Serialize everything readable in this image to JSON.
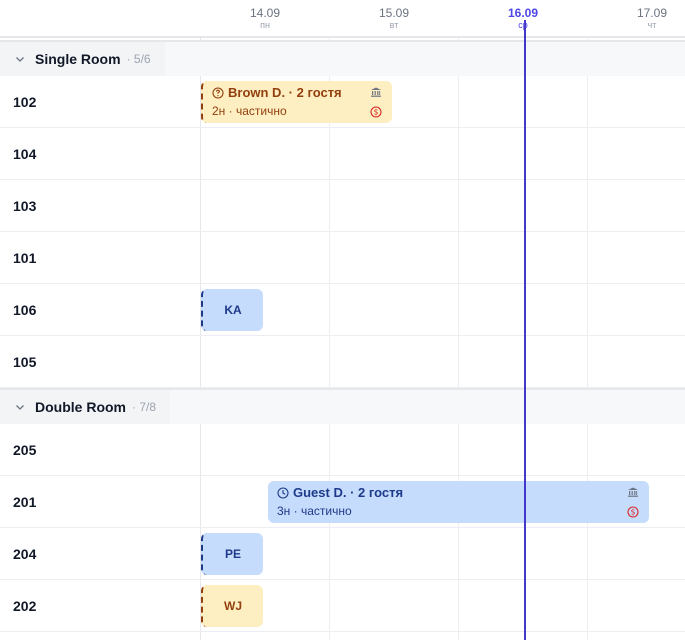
{
  "days": [
    {
      "date": "14.09",
      "dow": "пн",
      "today": false
    },
    {
      "date": "15.09",
      "dow": "вт",
      "today": false
    },
    {
      "date": "16.09",
      "dow": "ср",
      "today": true
    },
    {
      "date": "17.09",
      "dow": "чт",
      "today": false
    }
  ],
  "groups": [
    {
      "name": "Single Room",
      "count": "· 5/6",
      "rooms": [
        "102",
        "104",
        "103",
        "101",
        "106",
        "105"
      ]
    },
    {
      "name": "Double Room",
      "count": "· 7/8",
      "rooms": [
        "205",
        "201",
        "204",
        "202"
      ]
    }
  ],
  "bookings": {
    "brown": {
      "title": "Brown D. · 2 гостя",
      "sub": "2н · частично",
      "status_icon": "question-circle-icon",
      "color": "#fdefc2"
    },
    "ka": {
      "label": "KA",
      "color": "#c5dcfc"
    },
    "guest": {
      "title": "Guest D. · 2 гостя",
      "sub": "3н · частично",
      "status_icon": "clock-icon",
      "color": "#c5dcfc"
    },
    "pe": {
      "label": "PE",
      "color": "#c5dcfc"
    },
    "wj": {
      "label": "WJ",
      "color": "#fdefc2"
    }
  },
  "colors": {
    "today_line": "#4338ca",
    "grid": "#eceef1",
    "payment_icon": "#dc2626"
  }
}
